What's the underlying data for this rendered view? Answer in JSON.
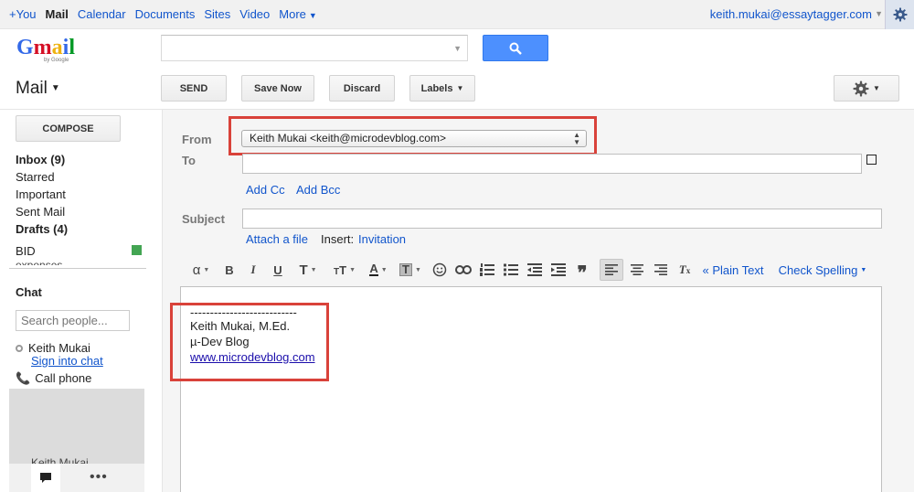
{
  "gbar": {
    "links": [
      "+You",
      "Mail",
      "Calendar",
      "Documents",
      "Sites",
      "Video",
      "More"
    ],
    "active": "Mail",
    "account": "keith.mukai@essaytagger.com"
  },
  "logo": {
    "word": "Gmail",
    "by": "by Google"
  },
  "search": {
    "value": ""
  },
  "toolbar": {
    "title": "Mail",
    "send": "SEND",
    "save_now": "Save Now",
    "discard": "Discard",
    "labels": "Labels"
  },
  "sidebar": {
    "compose": "COMPOSE",
    "items": [
      {
        "label": "Inbox (9)",
        "bold": true
      },
      {
        "label": "Starred",
        "bold": false
      },
      {
        "label": "Important",
        "bold": false
      },
      {
        "label": "Sent Mail",
        "bold": false
      },
      {
        "label": "Drafts (4)",
        "bold": true
      }
    ],
    "bid": {
      "label": "BID",
      "color": "#43a553"
    },
    "cut_label": "expenses"
  },
  "chat": {
    "heading": "Chat",
    "search_placeholder": "Search people...",
    "me": "Keith Mukai",
    "sign_in": "Sign into chat",
    "call": "Call phone",
    "clipped_name": "Keith Mukai"
  },
  "compose": {
    "from_label": "From",
    "from_value": "Keith Mukai <keith@microdevblog.com>",
    "to_label": "To",
    "add_cc": "Add Cc",
    "add_bcc": "Add Bcc",
    "subject_label": "Subject",
    "attach": "Attach a file",
    "insert_label": "Insert:",
    "invitation": "Invitation",
    "plain_text": "« Plain Text",
    "check_spelling": "Check Spelling",
    "highlight_color": "#d9423a"
  },
  "signature": {
    "rule": "---------------------------",
    "name": "Keith Mukai, M.Ed.",
    "blog": "µ-Dev Blog",
    "site": "www.microdevblog.com"
  }
}
